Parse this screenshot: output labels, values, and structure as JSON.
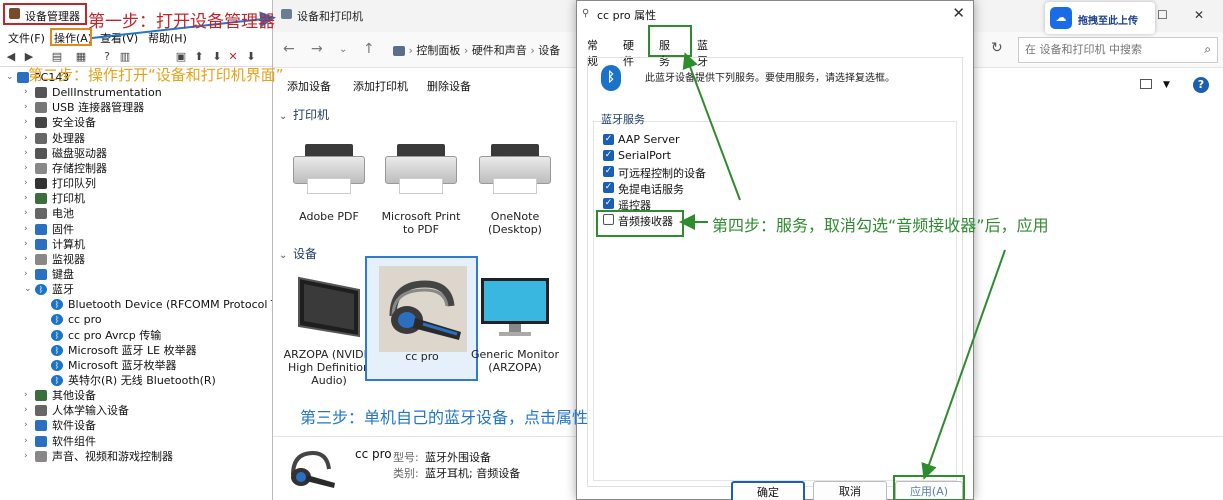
{
  "device_manager": {
    "title": "设备管理器",
    "menu": [
      "文件(F)",
      "操作(A)",
      "查看(V)",
      "帮助(H)"
    ],
    "tree": [
      {
        "label": "PC143",
        "level": 0,
        "expander": "⌄"
      },
      {
        "label": "DellInstrumentation",
        "level": 1,
        "expander": "›"
      },
      {
        "label": "USB 连接器管理器",
        "level": 1,
        "expander": "›"
      },
      {
        "label": "安全设备",
        "level": 1,
        "expander": "›"
      },
      {
        "label": "处理器",
        "level": 1,
        "expander": "›"
      },
      {
        "label": "磁盘驱动器",
        "level": 1,
        "expander": "›"
      },
      {
        "label": "存储控制器",
        "level": 1,
        "expander": "›"
      },
      {
        "label": "打印队列",
        "level": 1,
        "expander": "›"
      },
      {
        "label": "打印机",
        "level": 1,
        "expander": "›"
      },
      {
        "label": "电池",
        "level": 1,
        "expander": "›"
      },
      {
        "label": "固件",
        "level": 1,
        "expander": "›"
      },
      {
        "label": "计算机",
        "level": 1,
        "expander": "›"
      },
      {
        "label": "监视器",
        "level": 1,
        "expander": "›"
      },
      {
        "label": "键盘",
        "level": 1,
        "expander": "›"
      },
      {
        "label": "蓝牙",
        "level": 1,
        "expander": "⌄"
      },
      {
        "label": "Bluetooth Device (RFCOMM Protocol TDI)",
        "level": 2,
        "expander": ""
      },
      {
        "label": "cc pro",
        "level": 2,
        "expander": ""
      },
      {
        "label": "cc pro Avrcp 传输",
        "level": 2,
        "expander": ""
      },
      {
        "label": "Microsoft 蓝牙 LE 枚举器",
        "level": 2,
        "expander": ""
      },
      {
        "label": "Microsoft 蓝牙枚举器",
        "level": 2,
        "expander": ""
      },
      {
        "label": "英特尔(R) 无线 Bluetooth(R)",
        "level": 2,
        "expander": ""
      },
      {
        "label": "其他设备",
        "level": 1,
        "expander": "›"
      },
      {
        "label": "人体学输入设备",
        "level": 1,
        "expander": "›"
      },
      {
        "label": "软件设备",
        "level": 1,
        "expander": "›"
      },
      {
        "label": "软件组件",
        "level": 1,
        "expander": "›"
      },
      {
        "label": "声音、视频和游戏控制器",
        "level": 1,
        "expander": "›"
      }
    ]
  },
  "devices_printers": {
    "title": "设备和打印机",
    "breadcrumb": [
      "控制面板",
      "硬件和声音",
      "设备"
    ],
    "search_placeholder": "在 设备和打印机 中搜索",
    "commands": [
      "添加设备",
      "添加打印机",
      "删除设备"
    ],
    "printers_header": "打印机",
    "devices_header": "设备",
    "printers": [
      "Adobe PDF",
      "Microsoft Print to PDF",
      "OneNote (Desktop)"
    ],
    "devices": [
      "ARZOPA (NVIDIA High Definition Audio)",
      "cc pro",
      "Generic Monitor (ARZOPA)"
    ],
    "detail": {
      "name": "cc pro",
      "model_label": "型号:",
      "model_value": "蓝牙外围设备",
      "category_label": "类别:",
      "category_value": "蓝牙耳机; 音频设备"
    }
  },
  "dialog": {
    "title": "cc pro 属性",
    "tabs": [
      "常规",
      "硬件",
      "服务",
      "蓝牙"
    ],
    "active_tab": "服务",
    "intro": "此蓝牙设备提供下列服务。要使用服务，请选择复选框。",
    "group_title": "蓝牙服务",
    "services": [
      {
        "label": "AAP Server",
        "checked": true
      },
      {
        "label": "SerialPort",
        "checked": true
      },
      {
        "label": "可远程控制的设备",
        "checked": true
      },
      {
        "label": "免提电话服务",
        "checked": true
      },
      {
        "label": "遥控器",
        "checked": true
      },
      {
        "label": "音频接收器",
        "checked": false
      }
    ],
    "buttons": {
      "ok": "确定",
      "cancel": "取消",
      "apply": "应用(A)"
    }
  },
  "widget": {
    "label": "拖拽至此上传"
  },
  "annotations": {
    "step1": "第一步：打开设备管理器",
    "step2": "第二步：操作打开“设备和打印机界面”",
    "step3": "第三步：单机自己的蓝牙设备，点击属性",
    "step4": "第四步：服务，取消勾选“音频接收器”后，应用"
  },
  "colors": {
    "annotation_red": "#c0262c",
    "annotation_orange": "#e6a219",
    "annotation_blue": "#2176c9",
    "annotation_green": "#2e8b2e",
    "accent": "#1a5fb4"
  }
}
